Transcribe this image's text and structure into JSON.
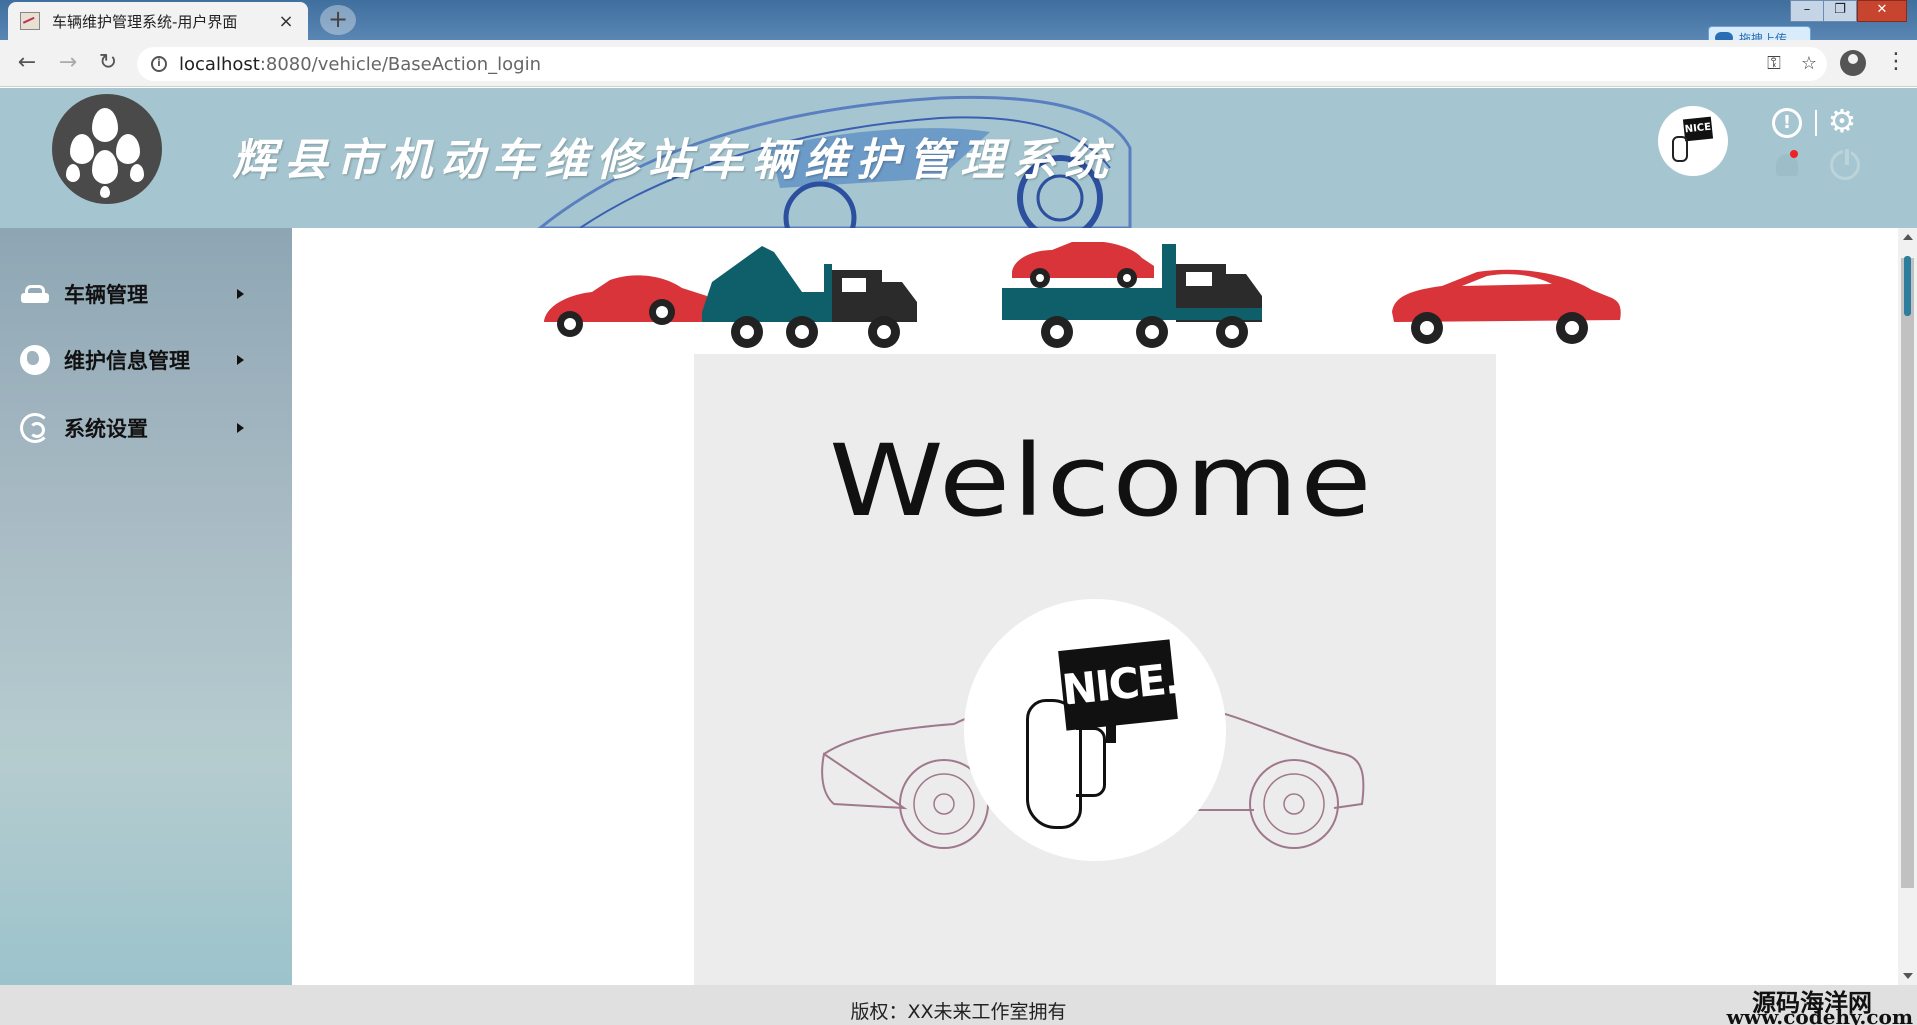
{
  "browser": {
    "tab_title": "车辆维护管理系统-用户界面",
    "tab_close": "×",
    "new_tab": "+",
    "url_host": "localhost",
    "url_path": ":8080/vehicle/BaseAction_login",
    "upload_badge": "拖拽上传",
    "nav": {
      "back": "←",
      "forward": "→",
      "reload": "↻"
    },
    "window_controls": {
      "minimize": "–",
      "restore": "❐",
      "close": "✕"
    },
    "omni_icons": {
      "key": "⚿",
      "star": "☆"
    },
    "menu_icon": "⋮"
  },
  "header": {
    "title": "辉县市机动车维修站车辆维护管理系统",
    "avatar_sign": "NICE",
    "alert_icon": "!",
    "gear_icon": "⚙"
  },
  "sidebar": {
    "items": [
      {
        "label": "车辆管理",
        "icon": "car-icon"
      },
      {
        "label": "维护信息管理",
        "icon": "globe-icon"
      },
      {
        "label": "系统设置",
        "icon": "swirl-icon"
      }
    ]
  },
  "main": {
    "welcome": "Welcome",
    "nice_sign": "NICE."
  },
  "footer": {
    "copyright": "版权：XX未来工作室拥有",
    "watermark_cn": "源码海洋网",
    "watermark_url": "www.codehy.com"
  },
  "colors": {
    "header_bg": "#a5c6d0",
    "truck_teal": "#0e5f6a",
    "car_red": "#d8343a"
  }
}
